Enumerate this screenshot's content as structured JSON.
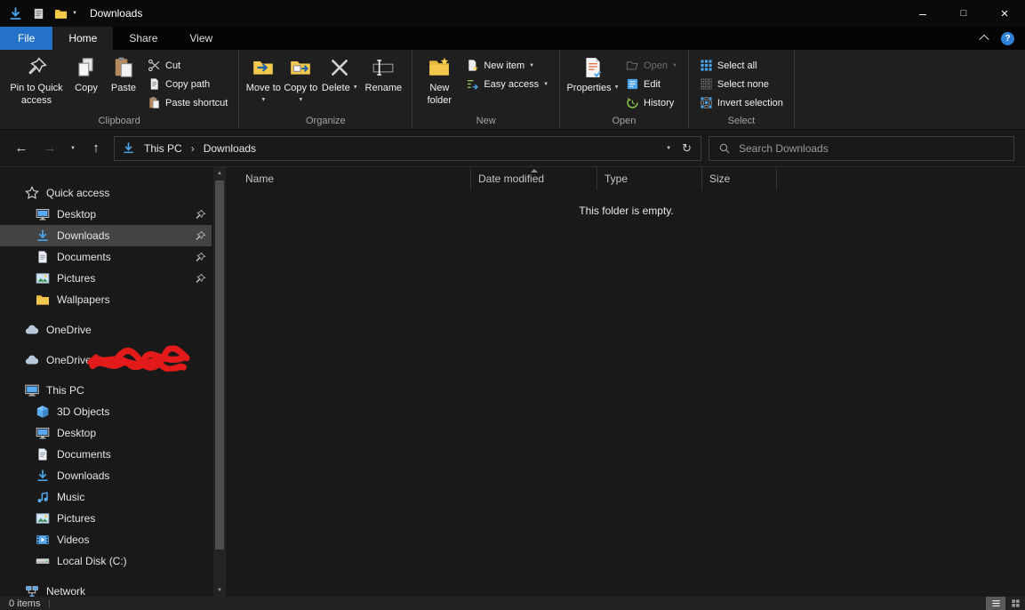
{
  "colors": {
    "accent_blue": "#2472c8",
    "selection_gray": "#434343",
    "folder_yellow": "#f2c94c",
    "downloads_blue": "#4aa3e8",
    "redaction_red": "#e21a1a"
  },
  "icons": {
    "back": "←",
    "forward": "→",
    "up": "↑",
    "refresh": "↻",
    "breadcrumb_sep": "›",
    "dropdown": "▼",
    "dropup": "▲",
    "minimize": "–",
    "maximize": "□",
    "close": "×",
    "help": "?"
  },
  "titlebar": {
    "title": "Downloads"
  },
  "tabs": {
    "file": "File",
    "home": "Home",
    "share": "Share",
    "view": "View"
  },
  "ribbon": {
    "clipboard": {
      "label": "Clipboard",
      "pin": "Pin to Quick access",
      "copy": "Copy",
      "paste": "Paste",
      "cut": "Cut",
      "copy_path": "Copy path",
      "paste_shortcut": "Paste shortcut"
    },
    "organize": {
      "label": "Organize",
      "move_to": "Move to",
      "copy_to": "Copy to",
      "del": "Delete",
      "rename": "Rename"
    },
    "new_group": {
      "label": "New",
      "new_folder": "New folder",
      "new_item": "New item",
      "easy_access": "Easy access"
    },
    "open_group": {
      "label": "Open",
      "properties": "Properties",
      "open": "Open",
      "edit": "Edit",
      "history": "History"
    },
    "select_group": {
      "label": "Select",
      "select_all": "Select all",
      "select_none": "Select none",
      "invert_selection": "Invert selection"
    }
  },
  "navbar": {
    "breadcrumb": [
      "This PC",
      "Downloads"
    ],
    "search_placeholder": "Search Downloads"
  },
  "sidebar": {
    "items": [
      {
        "label": "Quick access",
        "icon": "star",
        "level": 0
      },
      {
        "label": "Desktop",
        "icon": "desktop",
        "level": 1,
        "pinned": true
      },
      {
        "label": "Downloads",
        "icon": "downloads",
        "level": 1,
        "pinned": true,
        "selected": true
      },
      {
        "label": "Documents",
        "icon": "documents",
        "level": 1,
        "pinned": true
      },
      {
        "label": "Pictures",
        "icon": "pictures",
        "level": 1,
        "pinned": true
      },
      {
        "label": "Wallpapers",
        "icon": "folder",
        "level": 1
      },
      {
        "label": "OneDrive",
        "icon": "cloud",
        "level": 0,
        "gap_before": true
      },
      {
        "label": "OneDrive -",
        "icon": "cloud",
        "level": 0,
        "gap_before": true,
        "redacted": true
      },
      {
        "label": "This PC",
        "icon": "pc",
        "level": 0,
        "gap_before": true
      },
      {
        "label": "3D Objects",
        "icon": "cube",
        "level": 1
      },
      {
        "label": "Desktop",
        "icon": "desktop",
        "level": 1
      },
      {
        "label": "Documents",
        "icon": "documents",
        "level": 1
      },
      {
        "label": "Downloads",
        "icon": "downloads",
        "level": 1
      },
      {
        "label": "Music",
        "icon": "music",
        "level": 1
      },
      {
        "label": "Pictures",
        "icon": "pictures",
        "level": 1
      },
      {
        "label": "Videos",
        "icon": "videos",
        "level": 1
      },
      {
        "label": "Local Disk (C:)",
        "icon": "disk",
        "level": 1
      },
      {
        "label": "Network",
        "icon": "network",
        "level": 0,
        "gap_before": true
      }
    ]
  },
  "main": {
    "columns": [
      "Name",
      "Date modified",
      "Type",
      "Size"
    ],
    "sort_column": "Date modified",
    "empty_message": "This folder is empty."
  },
  "statusbar": {
    "item_count": "0 items"
  }
}
